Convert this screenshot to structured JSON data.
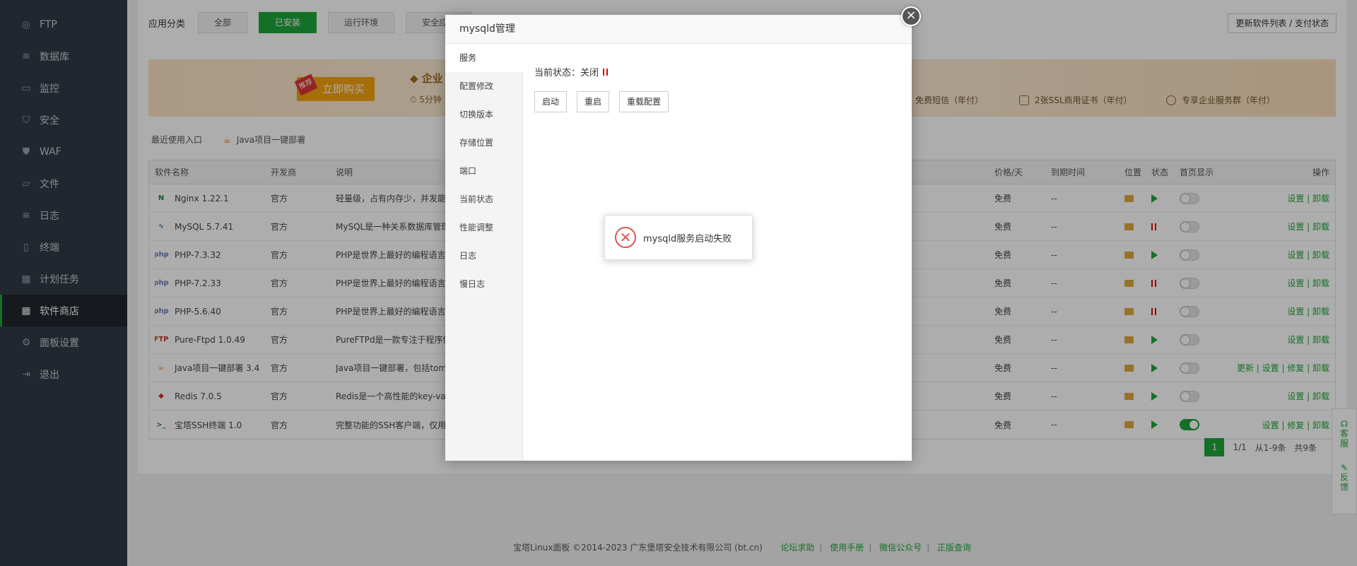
{
  "sidebar": {
    "items": [
      {
        "label": "FTP",
        "icon": "globe-icon"
      },
      {
        "label": "数据库",
        "icon": "database-icon"
      },
      {
        "label": "监控",
        "icon": "monitor-icon"
      },
      {
        "label": "安全",
        "icon": "shield-icon"
      },
      {
        "label": "WAF",
        "icon": "waf-shield-icon"
      },
      {
        "label": "文件",
        "icon": "folder-icon"
      },
      {
        "label": "日志",
        "icon": "log-icon"
      },
      {
        "label": "终端",
        "icon": "terminal-icon"
      },
      {
        "label": "计划任务",
        "icon": "calendar-icon"
      },
      {
        "label": "软件商店",
        "icon": "apps-icon"
      },
      {
        "label": "面板设置",
        "icon": "gear-icon"
      },
      {
        "label": "退出",
        "icon": "logout-icon"
      }
    ]
  },
  "header": {
    "category_label": "应用分类",
    "categories": [
      "全部",
      "已安装",
      "运行环境",
      "安全应用"
    ],
    "update_button": "更新软件列表 / 支付状态"
  },
  "banner": {
    "tag": "推荐",
    "buy_button": "立即购买",
    "title": "企业",
    "subtitle": "5分钟",
    "perks": [
      "免费短信（年付）",
      "2张SSL商用证书（年付）",
      "专享企业服务群（年付）"
    ]
  },
  "recent": {
    "label": "最近使用入口",
    "java_link": "Java项目一键部署"
  },
  "table": {
    "headers": {
      "name": "软件名称",
      "dev": "开发商",
      "desc": "说明",
      "price": "价格/天",
      "expire": "到期时间",
      "location": "位置",
      "state": "状态",
      "home": "首页显示",
      "op": "操作"
    },
    "rows": [
      {
        "name": "Nginx 1.22.1",
        "dev": "官方",
        "desc": "轻量级，占有内存少，并发能力",
        "price": "免费",
        "expire": "--",
        "state": "running",
        "home": false,
        "op": "设置 | 卸载",
        "icon": "nginx-icon",
        "icon_text": "N",
        "icon_color": "#1a8a3a"
      },
      {
        "name": "MySQL 5.7.41",
        "dev": "官方",
        "desc": "MySQL是一种关系数据库管理",
        "price": "免费",
        "expire": "--",
        "state": "stopped",
        "home": false,
        "op": "设置 | 卸载",
        "icon": "mysql-icon",
        "icon_text": "∿",
        "icon_color": "#4479a1"
      },
      {
        "name": "PHP-7.3.32",
        "dev": "官方",
        "desc": "PHP是世界上最好的编程语言",
        "price": "免费",
        "expire": "--",
        "state": "running",
        "home": false,
        "op": "设置 | 卸载",
        "icon": "php-icon",
        "icon_text": "php",
        "icon_color": "#6a7bb4"
      },
      {
        "name": "PHP-7.2.33",
        "dev": "官方",
        "desc": "PHP是世界上最好的编程语言",
        "price": "免费",
        "expire": "--",
        "state": "stopped",
        "home": false,
        "op": "设置 | 卸载",
        "icon": "php-icon",
        "icon_text": "php",
        "icon_color": "#6a7bb4"
      },
      {
        "name": "PHP-5.6.40",
        "dev": "官方",
        "desc": "PHP是世界上最好的编程语言",
        "price": "免费",
        "expire": "--",
        "state": "stopped",
        "home": false,
        "op": "设置 | 卸载",
        "icon": "php-icon",
        "icon_text": "php",
        "icon_color": "#6a7bb4"
      },
      {
        "name": "Pure-Ftpd 1.0.49",
        "dev": "官方",
        "desc": "PureFTPd是一款专注于程序健",
        "price": "免费",
        "expire": "--",
        "state": "running",
        "home": false,
        "op": "设置 | 卸载",
        "icon": "ftp-icon",
        "icon_text": "FTP",
        "icon_color": "#c0392b"
      },
      {
        "name": "Java项目一键部署 3.4",
        "dev": "官方",
        "desc": "Java项目一键部署，包括tom",
        "price": "免费",
        "expire": "--",
        "state": "running",
        "home": false,
        "op": "更新 | 设置 | 修复 | 卸载",
        "icon": "java-icon",
        "icon_text": "☕",
        "icon_color": "#e76f00"
      },
      {
        "name": "Redis 7.0.5",
        "dev": "官方",
        "desc": "Redis是一个高性能的key-val",
        "price": "免费",
        "expire": "--",
        "state": "running",
        "home": false,
        "op": "设置 | 卸载",
        "icon": "redis-icon",
        "icon_text": "◆",
        "icon_color": "#d82c20"
      },
      {
        "name": "宝塔SSH终端 1.0",
        "dev": "官方",
        "desc": "完整功能的SSH客户端，仅用",
        "price": "免费",
        "expire": "--",
        "state": "running",
        "home": true,
        "op": "设置 | 修复 | 卸载",
        "icon": "ssh-terminal-icon",
        "icon_text": ">_",
        "icon_color": "#2c7d3a"
      }
    ]
  },
  "pager": {
    "page": "1",
    "of": "1/1",
    "range": "从1-9条",
    "total": "共9条"
  },
  "footer": {
    "copyright": "宝塔Linux面板 ©2014-2023 广东堡塔安全技术有限公司 (bt.cn)",
    "links": [
      "论坛求助",
      "使用手册",
      "微信公众号",
      "正版查询"
    ]
  },
  "float": {
    "service": "客服",
    "feedback": "反馈"
  },
  "dialog": {
    "title": "mysqld管理",
    "nav": [
      "服务",
      "配置修改",
      "切换版本",
      "存储位置",
      "端口",
      "当前状态",
      "性能调整",
      "日志",
      "慢日志"
    ],
    "status_label": "当前状态：",
    "status_value": "关闭",
    "buttons": [
      "启动",
      "重启",
      "重载配置"
    ]
  },
  "toast": {
    "message": "mysqld服务启动失败"
  },
  "colors": {
    "accent": "#20a53a",
    "sidebar_bg": "#313a44",
    "error": "#e05252"
  }
}
